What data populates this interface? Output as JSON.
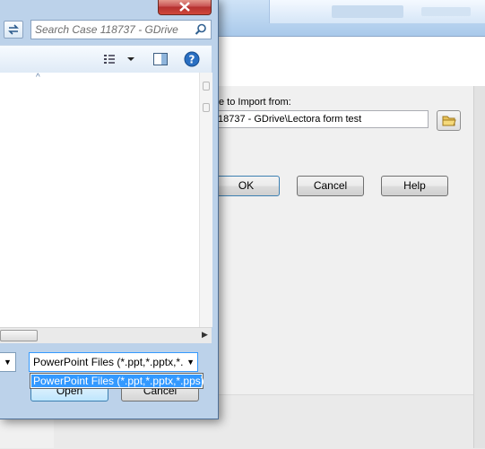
{
  "background_dialog": {
    "import_label": "e to Import from:",
    "import_path": "18737 - GDrive\\Lectora form test",
    "ok_label": "OK",
    "cancel_label": "Cancel",
    "help_label": "Help"
  },
  "file_dialog": {
    "search_placeholder": "Search Case 118737 - GDrive",
    "file_type_selected": "PowerPoint Files (*.ppt,*.pptx,*.",
    "open_label": "Open",
    "cancel_label": "Cancel",
    "file_type_options": [
      "PowerPoint Files (*.ppt,*.pptx,*.pps)"
    ]
  },
  "colors": {
    "selection": "#3399ff",
    "frame": "#bcd2ea",
    "close_button": "#c75050"
  }
}
